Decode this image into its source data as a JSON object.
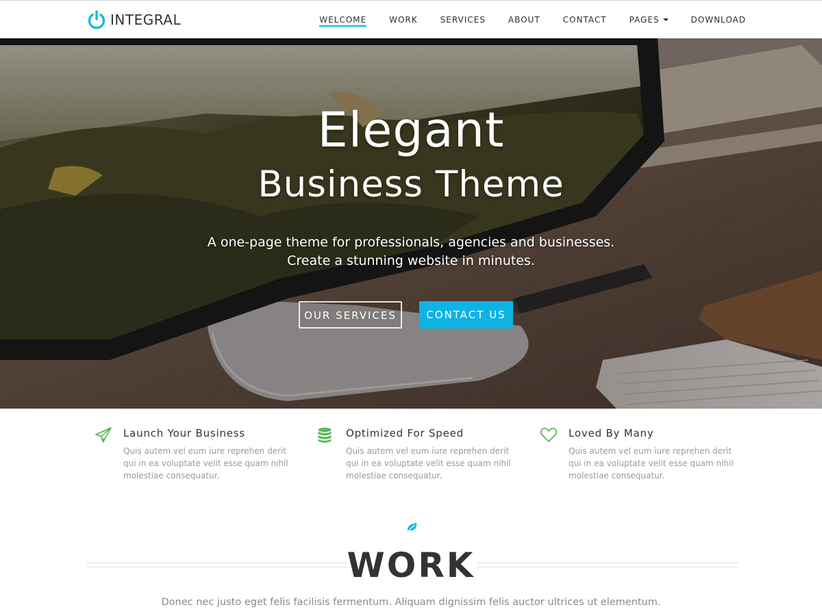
{
  "colors": {
    "accent": "#0eb3e6",
    "feature_icon": "#5cb85c",
    "heading": "#333333",
    "muted_text": "#9a9a9a"
  },
  "brand": {
    "name": "INTEGRAL",
    "icon": "power-icon"
  },
  "nav": {
    "items": [
      {
        "label": "WELCOME",
        "active": true
      },
      {
        "label": "WORK",
        "active": false
      },
      {
        "label": "SERVICES",
        "active": false
      },
      {
        "label": "ABOUT",
        "active": false
      },
      {
        "label": "CONTACT",
        "active": false
      },
      {
        "label": "PAGES",
        "active": false,
        "dropdown": true
      },
      {
        "label": "DOWNLOAD",
        "active": false
      }
    ]
  },
  "hero": {
    "title_line1": "Elegant",
    "title_line2": "Business Theme",
    "subtitle_line1": "A one-page theme for professionals, agencies and businesses.",
    "subtitle_line2": "Create a stunning website in minutes.",
    "primary_button": "CONTACT US",
    "secondary_button": "OUR SERVICES"
  },
  "features": [
    {
      "icon": "paper-plane-icon",
      "title": "Launch Your Business",
      "text": "Quis autem vel eum iure reprehen derit qui in ea voluptate velit esse quam nihil molestiae consequatur."
    },
    {
      "icon": "database-icon",
      "title": "Optimized For Speed",
      "text": "Quis autem vel eum iure reprehen derit qui in ea voluptate velit esse quam nihil molestiae consequatur."
    },
    {
      "icon": "heart-icon",
      "title": "Loved By Many",
      "text": "Quis autem vel eum iure reprehen derit qui in ea voluptate velit esse quam nihil molestiae consequatur."
    }
  ],
  "work": {
    "icon": "leaf-icon",
    "title": "WORK",
    "subtitle": "Donec nec justo eget felis facilisis fermentum. Aliquam dignissim felis auctor ultrices ut elementum."
  }
}
